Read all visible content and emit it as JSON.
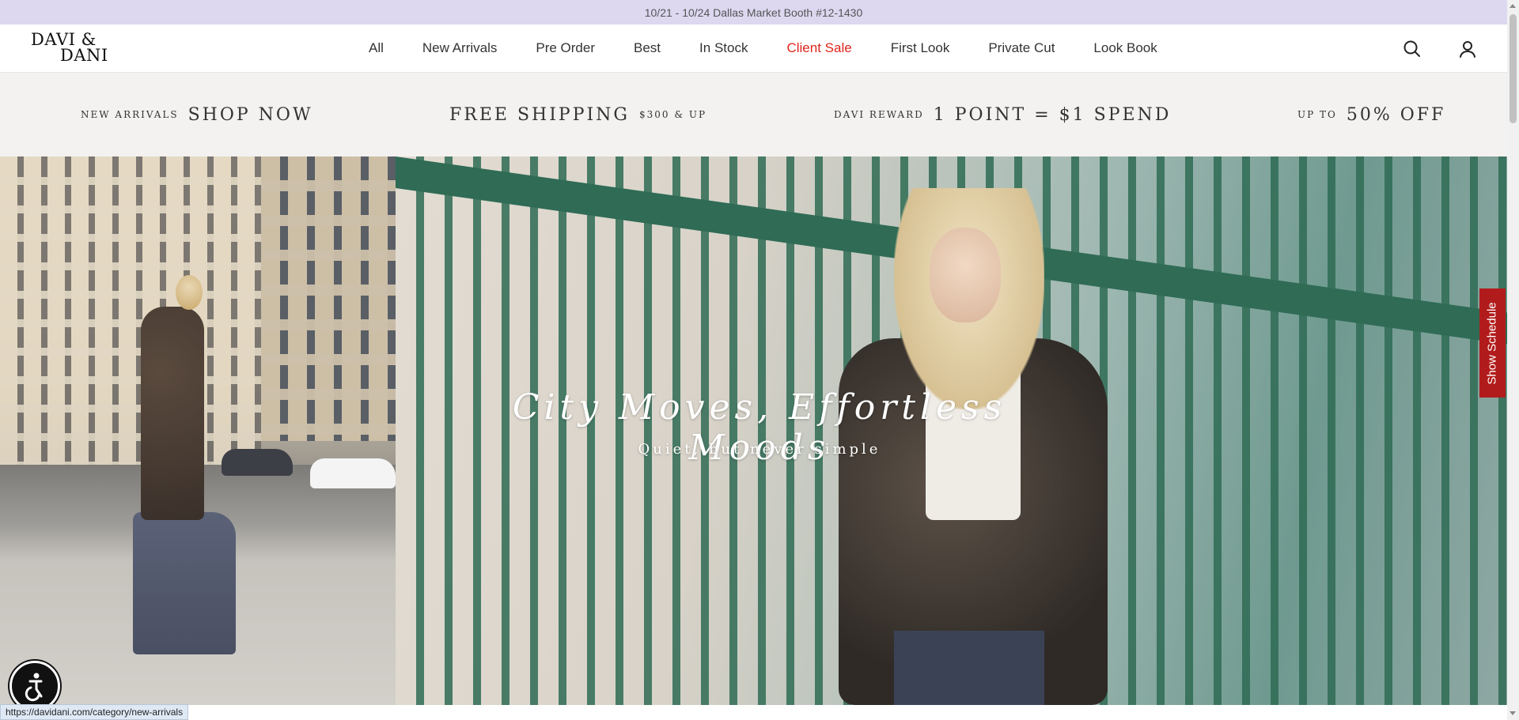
{
  "announcement": {
    "text": "10/21 - 10/24 Dallas Market Booth #12-1430"
  },
  "header": {
    "logo_line1": "DAVI &",
    "logo_line2": "DANI",
    "nav": [
      {
        "label": "All"
      },
      {
        "label": "New Arrivals"
      },
      {
        "label": "Pre Order"
      },
      {
        "label": "Best"
      },
      {
        "label": "In Stock"
      },
      {
        "label": "Client Sale",
        "color": "#e0261c"
      },
      {
        "label": "First Look"
      },
      {
        "label": "Private Cut"
      },
      {
        "label": "Look Book"
      }
    ],
    "icons": {
      "search": "search-icon",
      "account": "user-icon"
    }
  },
  "promo": {
    "new_arrivals_small": "NEW ARRIVALS",
    "new_arrivals_large": "SHOP NOW",
    "free_shipping_large": "FREE SHIPPING",
    "free_shipping_small": "$300 & UP",
    "reward_small": "DAVI REWARD",
    "reward_large": "1 POINT = $1 SPEND",
    "discount_small": "UP TO",
    "discount_large": "50% OFF"
  },
  "hero": {
    "title": "City Moves, Effortless Moods",
    "subtitle": "Quiet, but never simple"
  },
  "schedule_tab": {
    "label": "Show Schedule",
    "color": "#b21b1b"
  },
  "accessibility": {
    "icon": "accessibility-icon"
  },
  "status_url": "https://davidani.com/category/new-arrivals",
  "colors": {
    "announcement_bg": "#ddd8f0",
    "promo_bg": "#f3f2f0",
    "sale": "#e0261c"
  }
}
